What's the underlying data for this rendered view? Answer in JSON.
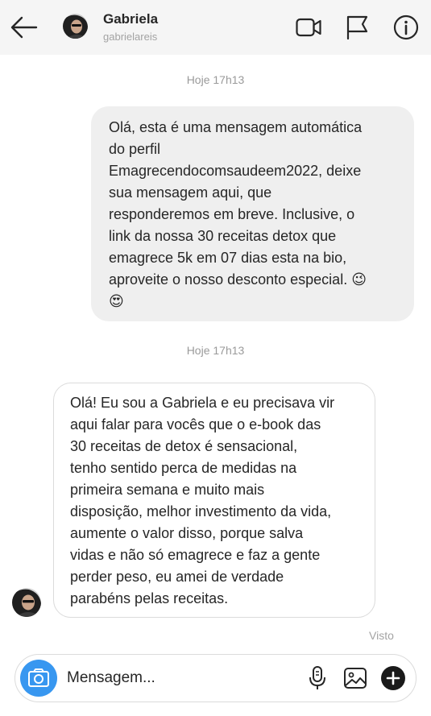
{
  "header": {
    "name": "Gabriela",
    "username": "gabrielareis"
  },
  "messages": [
    {
      "timestamp": "Hoje 17h13",
      "direction": "outgoing",
      "text": "Olá, esta é uma mensagem automática\ndo perfil\nEmagrecendocomsaudeem2022, deixe\nsua mensagem aqui, que\nresponderemos em breve. Inclusive, o\nlink da nossa 30 receitas detox que\nemagrece 5k em 07 dias esta na bio,\naproveite o nosso desconto especial. 😉\n😍"
    },
    {
      "timestamp": "Hoje 17h13",
      "direction": "incoming",
      "text": "Olá! Eu sou a Gabriela e eu precisava vir\naqui falar para vocês que o e-book das\n30 receitas de detox é sensacional,\ntenho sentido perca de medidas na\nprimeira semana e muito mais\ndisposição, melhor investimento da vida,\naumente o valor disso, porque salva\nvidas e não só emagrece e faz a gente\nperder peso, eu amei de verdade\nparabéns pelas receitas."
    }
  ],
  "status": {
    "seen": "Visto"
  },
  "composer": {
    "placeholder": "Mensagem..."
  },
  "icons": {
    "back": "arrow-left-icon",
    "video": "video-camera-icon",
    "report": "flag-icon",
    "info": "info-icon",
    "camera": "camera-icon",
    "mic": "microphone-icon",
    "gallery": "image-icon",
    "more": "plus-icon"
  },
  "colors": {
    "header_bg": "#f5f5f5",
    "outgoing_bubble": "#efefef",
    "camera_button": "#3897f0",
    "timestamp": "#9a9a9a"
  }
}
